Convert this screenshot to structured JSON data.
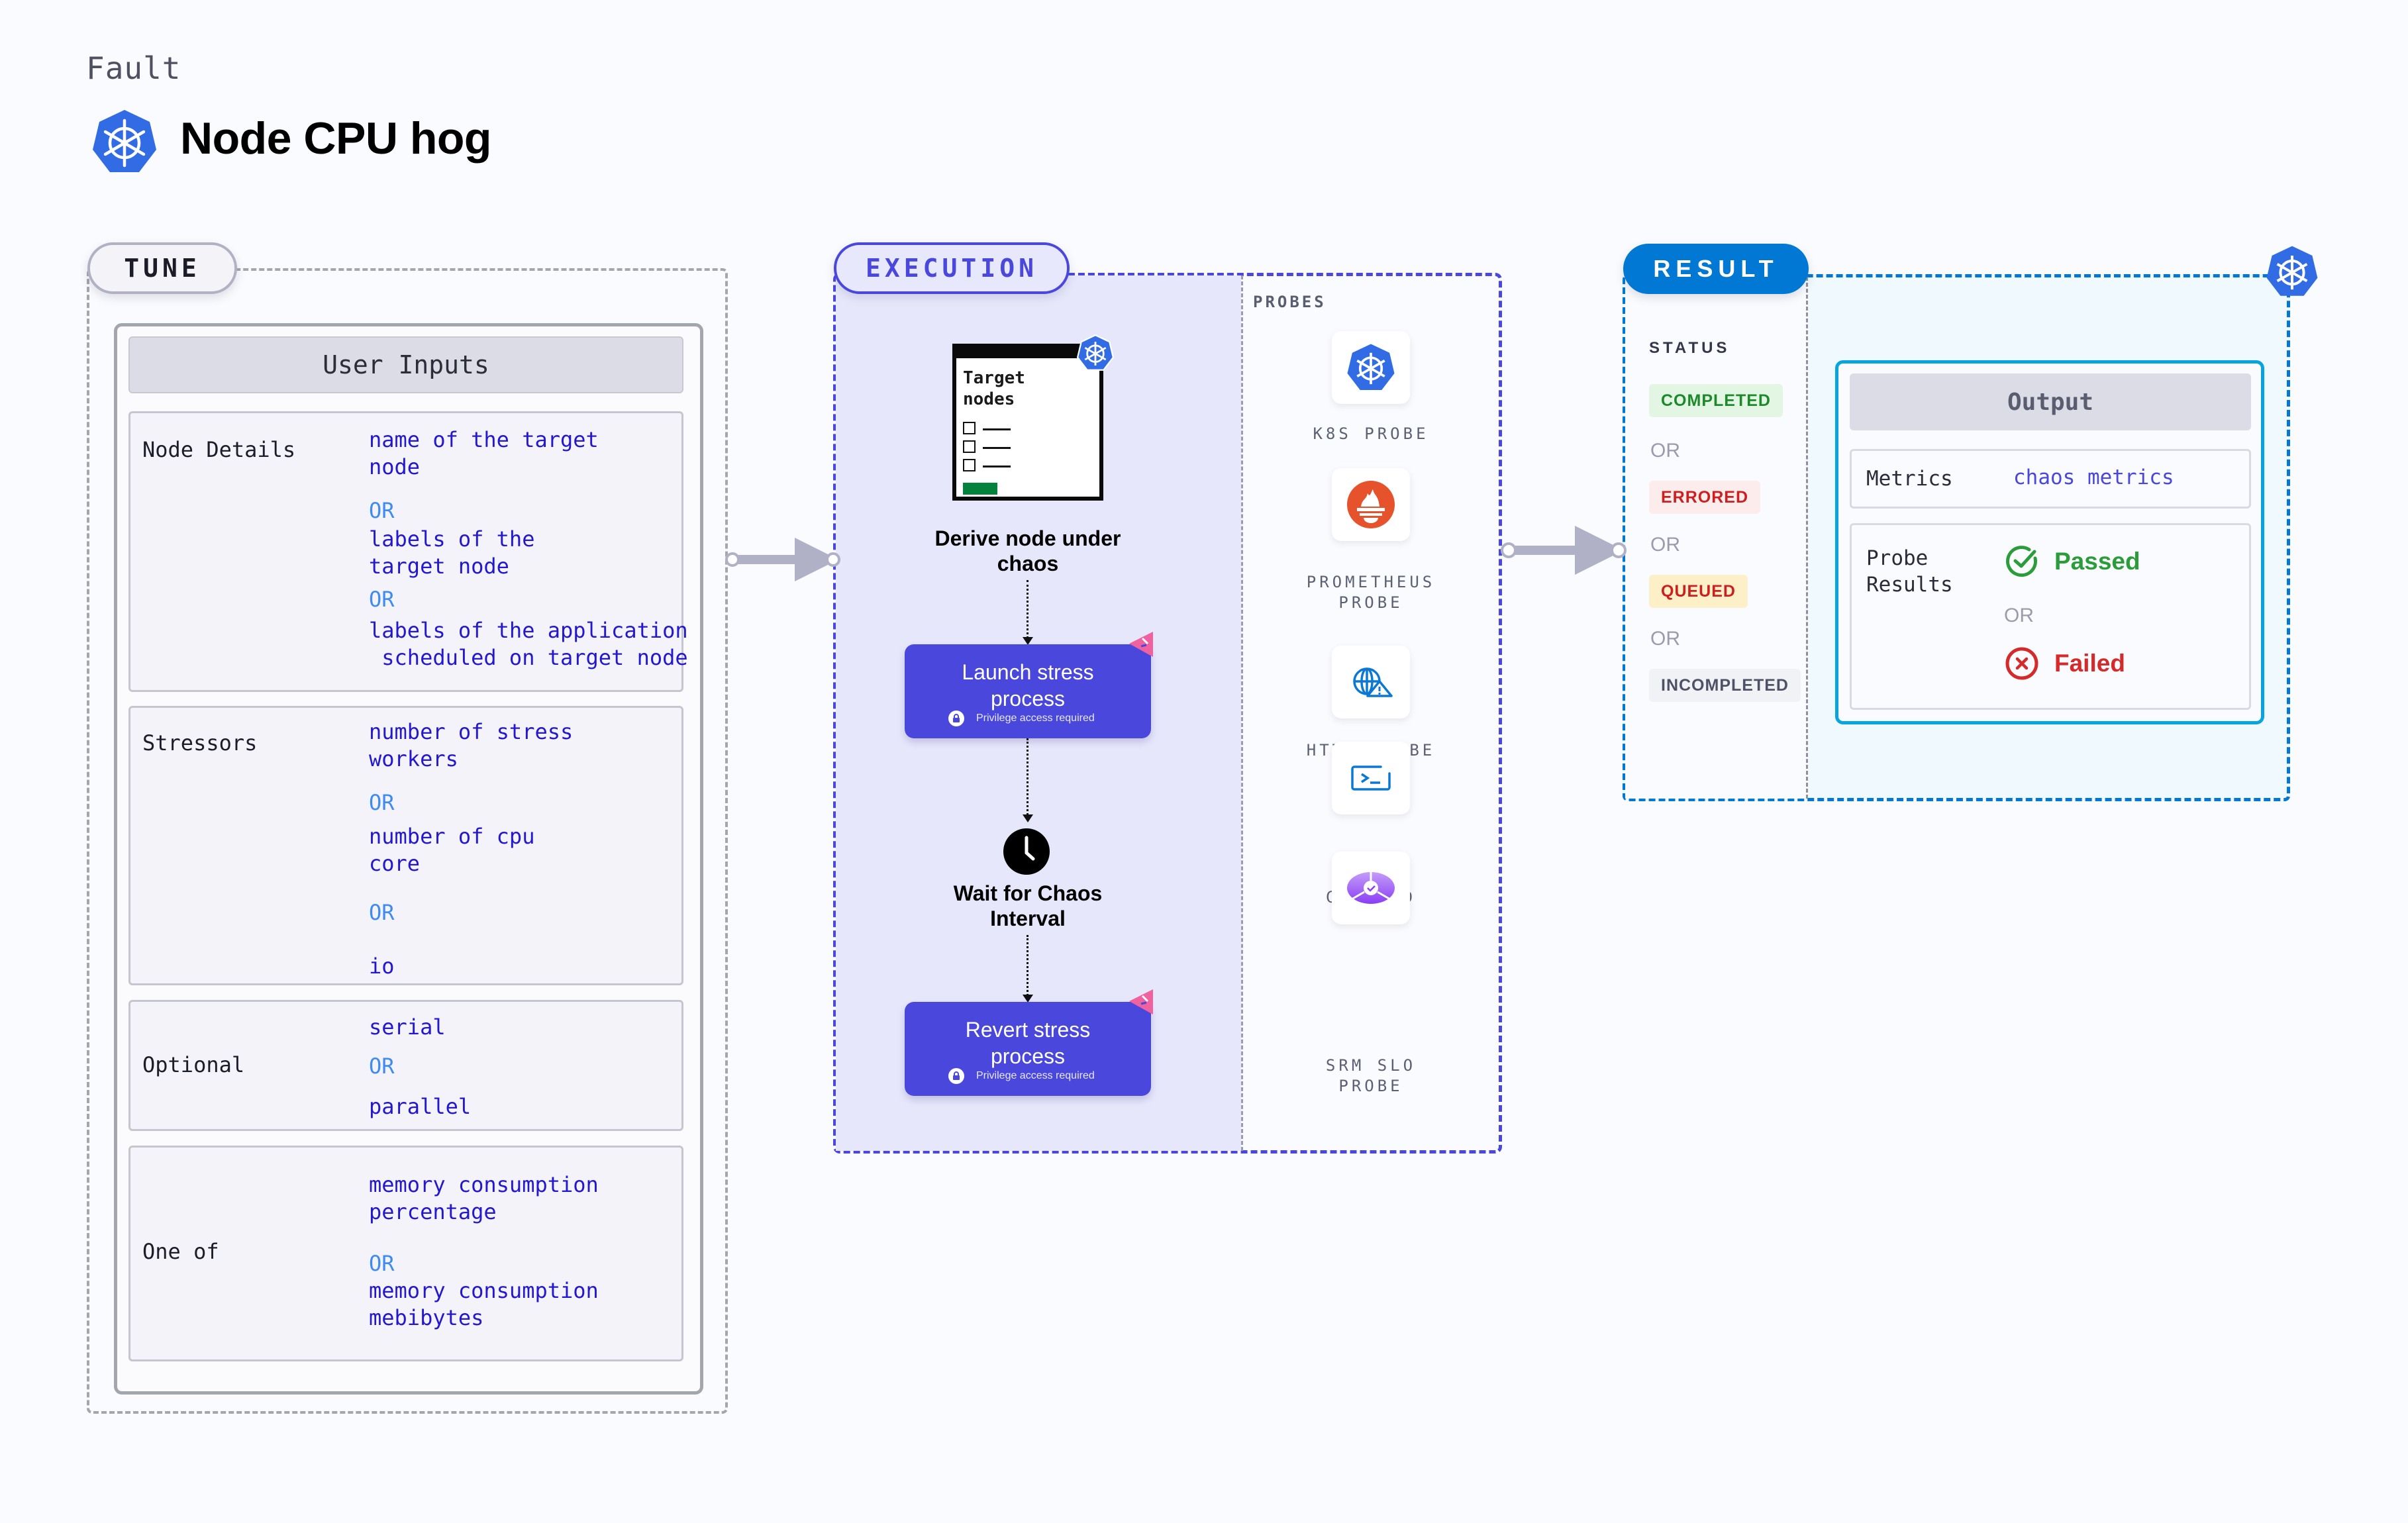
{
  "header": {
    "eyebrow": "Fault",
    "title": "Node CPU hog",
    "title_icon": "kubernetes-icon"
  },
  "tune": {
    "pill_label": "TUNE",
    "card_title": "User Inputs",
    "sections": [
      {
        "label": "Node Details",
        "options": [
          "name of the target\nnode",
          "labels of the\ntarget node",
          "labels of the application\n scheduled on target node"
        ],
        "separator": "OR"
      },
      {
        "label": "Stressors",
        "options": [
          "number of stress\nworkers",
          "number of cpu\ncore",
          "io"
        ],
        "separator": "OR"
      },
      {
        "label": "Optional",
        "options": [
          "serial",
          "parallel"
        ],
        "separator": "OR"
      },
      {
        "label": "One of",
        "options": [
          "memory consumption\npercentage",
          "memory consumption\nmebibytes"
        ],
        "separator": "OR"
      }
    ]
  },
  "execution": {
    "pill_label": "EXECUTION",
    "target_card": {
      "title": "Target\nnodes",
      "icon": "kubernetes-icon"
    },
    "steps": [
      {
        "title": "Derive node under\nchaos",
        "type": "text"
      },
      {
        "title": "Launch stress\nprocess",
        "type": "action",
        "note": "Privilege access required"
      },
      {
        "title": "Wait for Chaos\nInterval",
        "type": "wait",
        "icon": "clock-icon"
      },
      {
        "title": "Revert stress\nprocess",
        "type": "action",
        "note": "Privilege access required"
      }
    ],
    "probes": {
      "label": "PROBES",
      "items": [
        {
          "label": "K8S PROBE",
          "icon": "kubernetes-icon"
        },
        {
          "label": "PROMETHEUS\nPROBE",
          "icon": "prometheus-icon"
        },
        {
          "label": "HTTP PROBE",
          "icon": "globe-warning-icon"
        },
        {
          "label": "COMMAND\nPROBE",
          "icon": "terminal-icon"
        },
        {
          "label": "SRM SLO\nPROBE",
          "icon": "slo-icon"
        }
      ]
    }
  },
  "result": {
    "pill_label": "RESULT",
    "status_label": "STATUS",
    "separator": "OR",
    "statuses": [
      {
        "label": "COMPLETED",
        "color": "#1b8a2a",
        "bg": "#e3f6e3"
      },
      {
        "label": "ERRORED",
        "color": "#cc1f1f",
        "bg": "#fdecec"
      },
      {
        "label": "QUEUED",
        "color": "#cc1f1f",
        "bg": "#fdf0c8"
      },
      {
        "label": "INCOMPLETED",
        "color": "#4f5266",
        "bg": "#f1f2f6"
      }
    ],
    "output": {
      "title": "Output",
      "metrics_label": "Metrics",
      "metrics_value": "chaos metrics",
      "probe_results_label": "Probe\nResults",
      "passed": "Passed",
      "failed": "Failed",
      "separator": "OR"
    }
  },
  "colors": {
    "execution_accent": "#4a48dc",
    "result_accent": "#0278d5",
    "output_border": "#08a4de",
    "option_text": "#2318cf",
    "or_text": "#3f8cf0",
    "passed": "#2a9d3a",
    "failed": "#d42a2a"
  }
}
